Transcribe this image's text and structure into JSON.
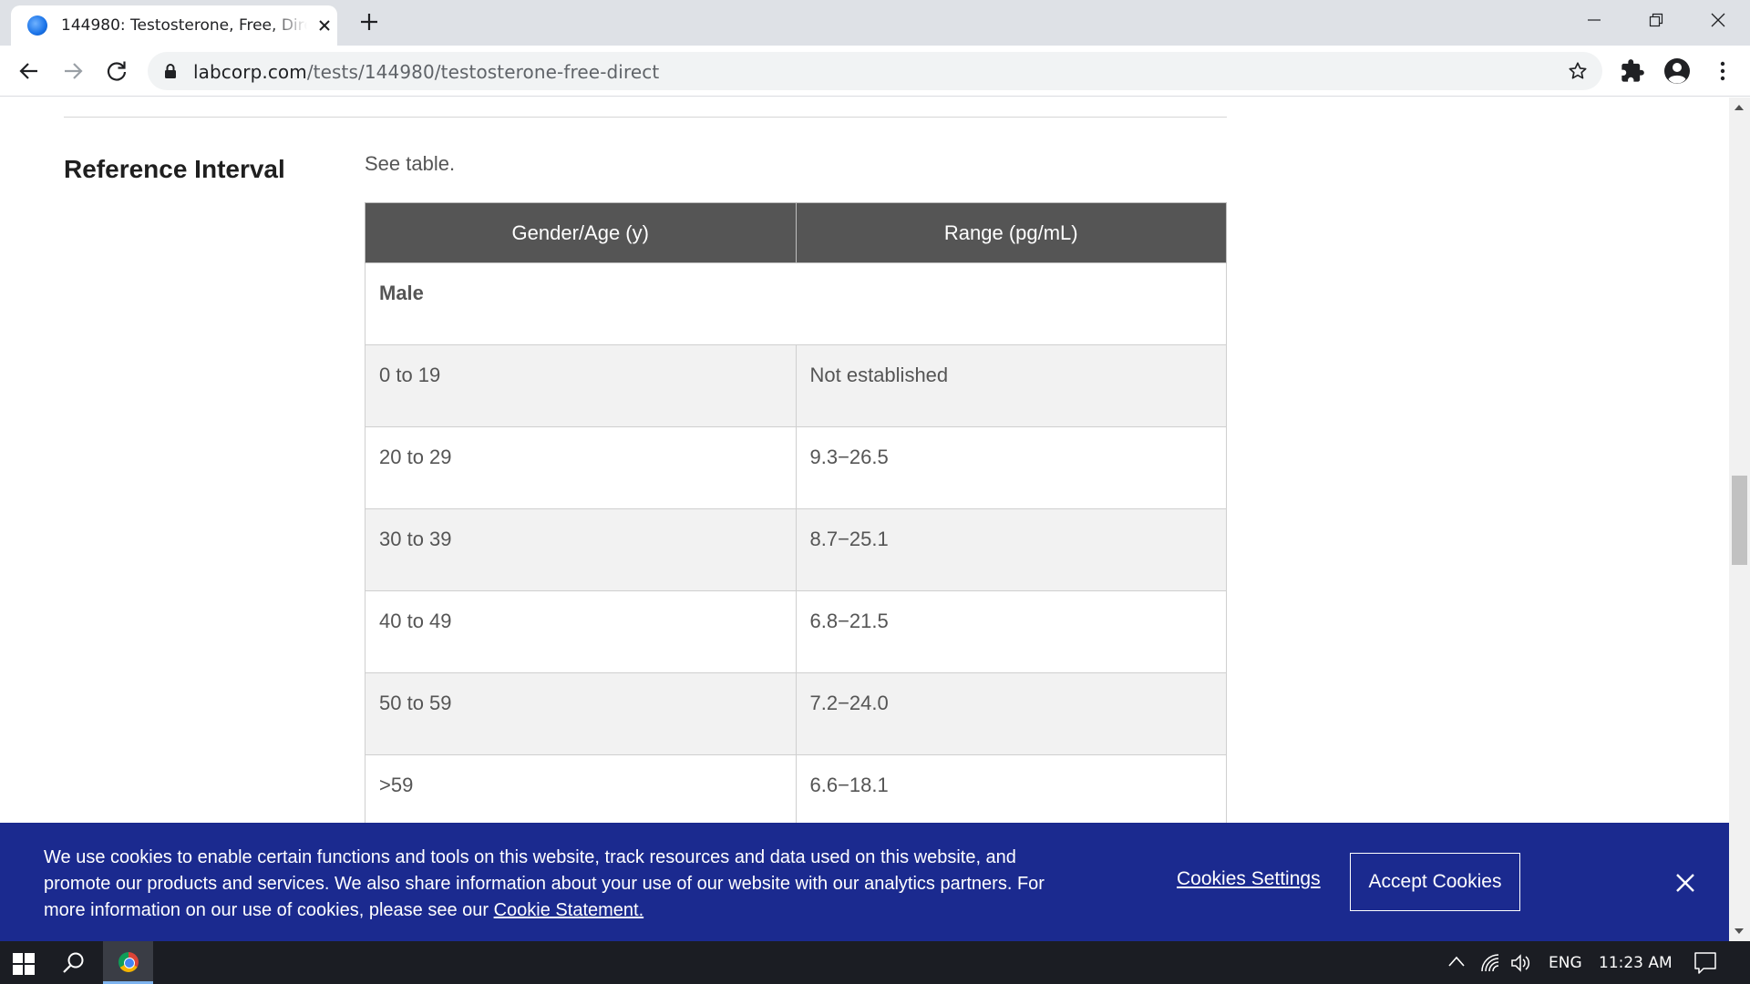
{
  "browser": {
    "tab_title": "144980: Testosterone, Free, Direct",
    "url_host": "labcorp.com",
    "url_path": "/tests/144980/testosterone-free-direct"
  },
  "page": {
    "section_title": "Reference Interval",
    "intro_text": "See table.",
    "table": {
      "headers": [
        "Gender/Age (y)",
        "Range (pg/mL)"
      ],
      "group_label": "Male",
      "rows": [
        {
          "age": "0 to 19",
          "range": "Not established"
        },
        {
          "age": "20 to 29",
          "range": "9.3−26.5"
        },
        {
          "age": "30 to 39",
          "range": "8.7−25.1"
        },
        {
          "age": "40 to 49",
          "range": "6.8−21.5"
        },
        {
          "age": "50 to 59",
          "range": "7.2−24.0"
        },
        {
          "age": ">59",
          "range": "6.6−18.1"
        }
      ]
    }
  },
  "cookie_banner": {
    "message": "We use cookies to enable certain functions and tools on this website, track resources and data used on this website, and promote our products and services. We also share information about your use of our website with our analytics partners. For more information on our use of cookies, please see our ",
    "statement_link": "Cookie Statement.",
    "settings_label": "Cookies Settings",
    "accept_label": "Accept Cookies"
  },
  "taskbar": {
    "language": "ENG",
    "time": "11:23 AM"
  },
  "colors": {
    "table_header_bg": "#555555",
    "cookie_banner_bg": "#1b2a8f",
    "taskbar_bg": "#1b1d23",
    "tabstrip_bg": "#dee1e6"
  }
}
